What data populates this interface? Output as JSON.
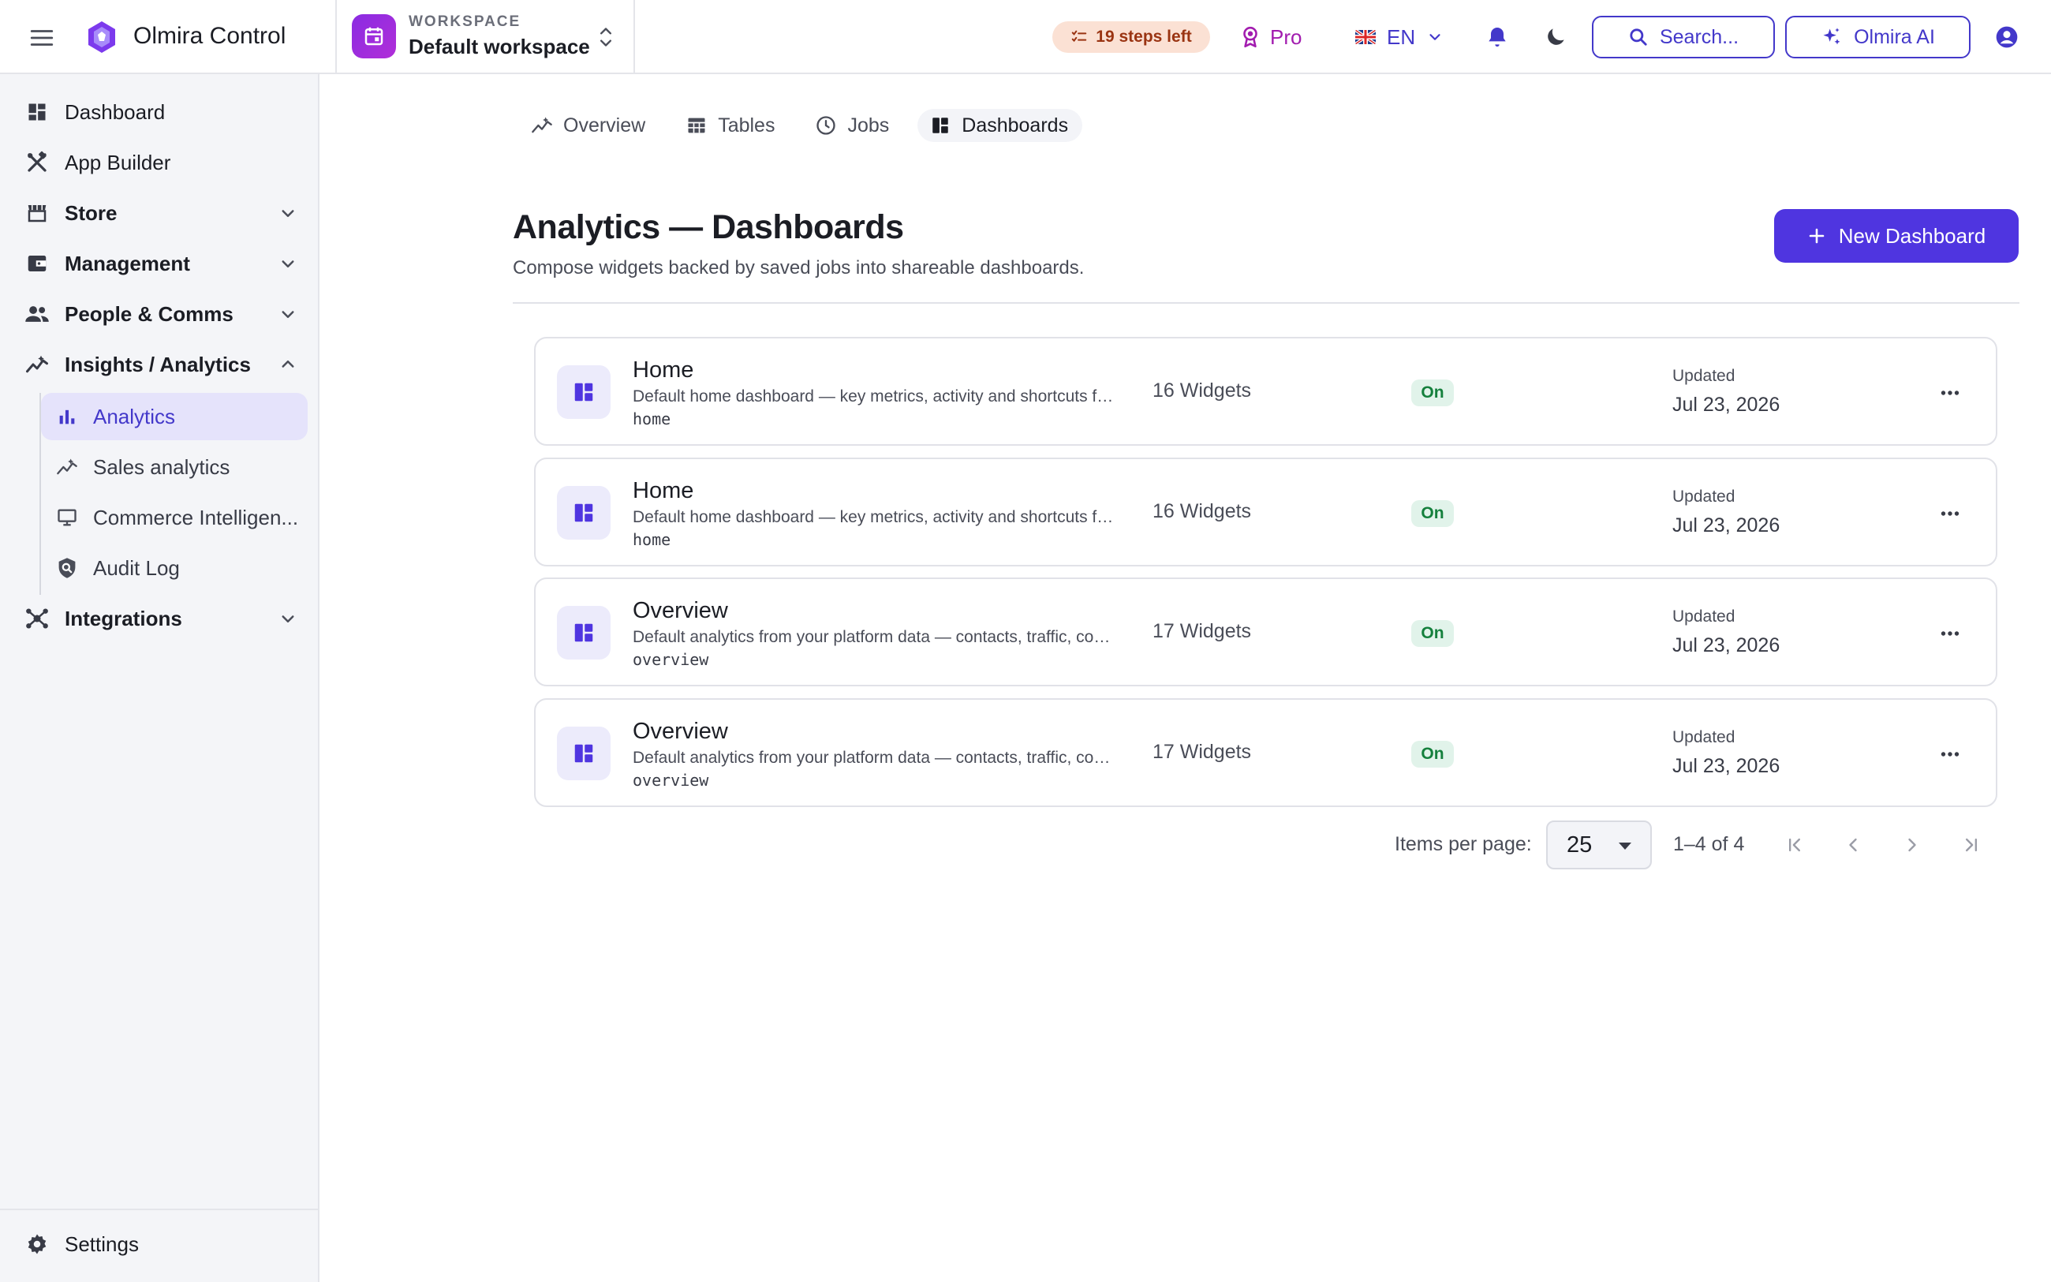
{
  "app": {
    "name": "Olmira Control",
    "workspace_kicker": "WORKSPACE",
    "workspace_name": "Default workspace"
  },
  "topbar": {
    "steps_left": "19 steps left",
    "plan": "Pro",
    "language": "EN",
    "search_label": "Search...",
    "ai_label": "Olmira AI"
  },
  "sidebar": {
    "items": [
      {
        "label": "Dashboard",
        "icon": "dashboard-icon"
      },
      {
        "label": "App Builder",
        "icon": "app-builder-icon"
      },
      {
        "label": "Store",
        "icon": "store-icon",
        "expanded": false
      },
      {
        "label": "Management",
        "icon": "wallet-icon",
        "expanded": false
      },
      {
        "label": "People & Comms",
        "icon": "people-icon",
        "expanded": false
      },
      {
        "label": "Insights / Analytics",
        "icon": "insights-icon",
        "expanded": true
      },
      {
        "label": "Integrations",
        "icon": "integrations-icon",
        "expanded": false
      }
    ],
    "sub_items": [
      {
        "label": "Analytics",
        "icon": "bar-chart-icon",
        "active": true
      },
      {
        "label": "Sales analytics",
        "icon": "trend-icon",
        "active": false
      },
      {
        "label": "Commerce Intelligen...",
        "icon": "monitor-icon",
        "active": false
      },
      {
        "label": "Audit Log",
        "icon": "shield-icon",
        "active": false
      }
    ],
    "settings_label": "Settings"
  },
  "tabs": [
    {
      "label": "Overview",
      "icon": "trend-icon",
      "active": false
    },
    {
      "label": "Tables",
      "icon": "table-icon",
      "active": false
    },
    {
      "label": "Jobs",
      "icon": "clock-icon",
      "active": false
    },
    {
      "label": "Dashboards",
      "icon": "dashboard-icon",
      "active": true
    }
  ],
  "page": {
    "title": "Analytics — Dashboards",
    "subtitle": "Compose widgets backed by saved jobs into shareable dashboards.",
    "new_button": "New Dashboard"
  },
  "dashboards": [
    {
      "title": "Home",
      "description": "Default home dashboard — key metrics, activity and shortcuts for your workspace",
      "slug": "home",
      "widgets": "16 Widgets",
      "status": "On",
      "updated_label": "Updated",
      "updated_date": "Jul 23, 2026"
    },
    {
      "title": "Home",
      "description": "Default home dashboard — key metrics, activity and shortcuts for your workspace",
      "slug": "home",
      "widgets": "16 Widgets",
      "status": "On",
      "updated_label": "Updated",
      "updated_date": "Jul 23, 2026"
    },
    {
      "title": "Overview",
      "description": "Default analytics from your platform data — contacts, traffic, commerce and more",
      "slug": "overview",
      "widgets": "17 Widgets",
      "status": "On",
      "updated_label": "Updated",
      "updated_date": "Jul 23, 2026"
    },
    {
      "title": "Overview",
      "description": "Default analytics from your platform data — contacts, traffic, commerce and more",
      "slug": "overview",
      "widgets": "17 Widgets",
      "status": "On",
      "updated_label": "Updated",
      "updated_date": "Jul 23, 2026"
    }
  ],
  "pagination": {
    "items_per_page_label": "Items per page:",
    "page_size": "25",
    "range": "1–4 of 4"
  },
  "colors": {
    "accent": "#4f35e0",
    "accent_text": "#4338ca",
    "active_bg": "#e5e3fb",
    "badge_bg": "#e1f3ea",
    "badge_text": "#15803d",
    "steps_bg": "#fbe1d4",
    "pro": "#a21caf"
  }
}
